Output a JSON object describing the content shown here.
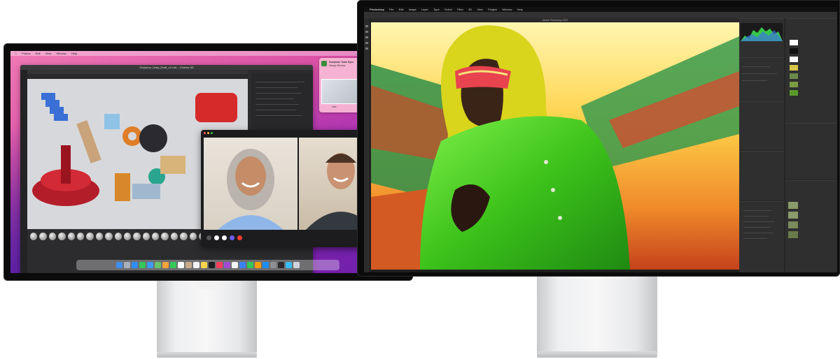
{
  "left_display": {
    "menubar_items": [
      "Photos",
      "Edit",
      "View",
      "Window",
      "Help"
    ],
    "app_window_title": "Sculpture_Daily_Draft_v2.c4d – Cinema 4D",
    "notification": {
      "title": "Sculpture Team Sync",
      "subtitle": "Design Review",
      "action": "Join"
    },
    "facetime_participants": 2
  },
  "right_display": {
    "app_name": "Photoshop",
    "menubar_items": [
      "Photoshop",
      "File",
      "Edit",
      "Image",
      "Layer",
      "Type",
      "Select",
      "Filter",
      "3D",
      "View",
      "Plugins",
      "Window",
      "Help"
    ],
    "document_title": "Adobe Photoshop 2022",
    "panels": [
      "Histogram",
      "Properties",
      "Layers",
      "Channels",
      "Adjustments",
      "History"
    ]
  },
  "colors": {
    "desktop_pink": "#e06aa9",
    "desktop_purple": "#6a2ab8",
    "raincoat_green": "#4fd21e",
    "hood_yellow": "#d8d21a",
    "stand_silver": "#e6e7e8"
  }
}
